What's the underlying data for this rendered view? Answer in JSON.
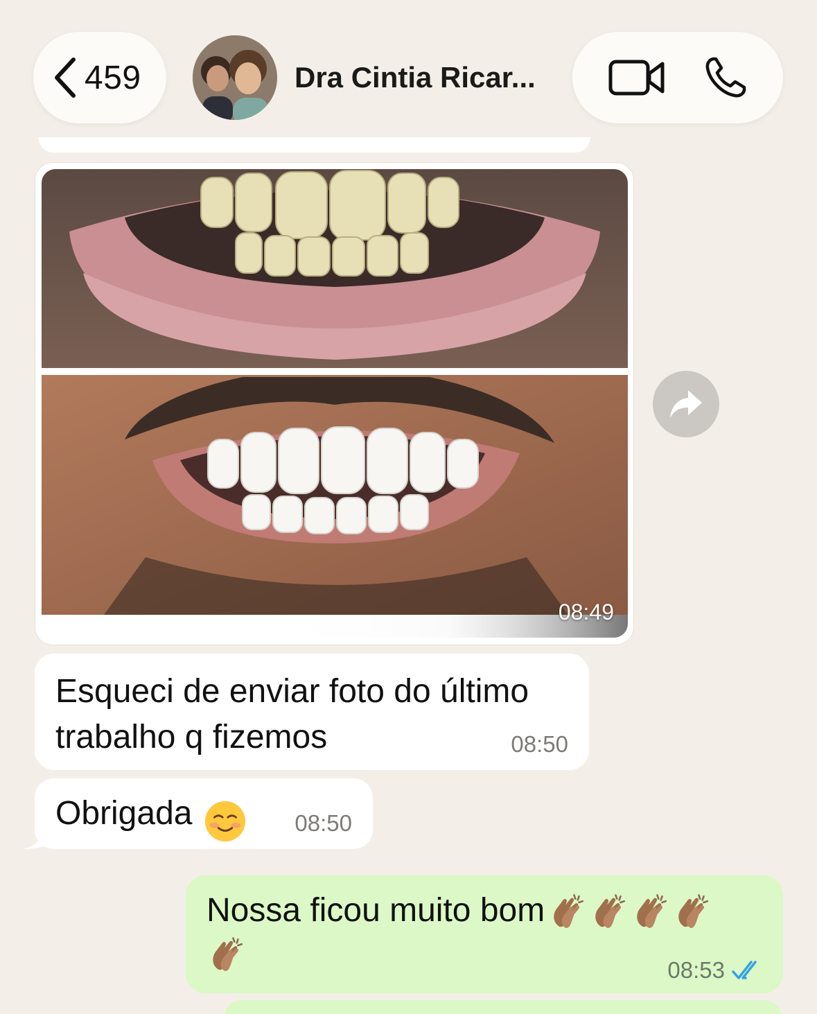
{
  "header": {
    "back_count": "459",
    "contact_name": "Dra Cintia Ricar...",
    "icons": [
      "chevron-left-icon",
      "video-camera-icon",
      "phone-icon"
    ]
  },
  "messages": [
    {
      "type": "image",
      "direction": "incoming",
      "time": "08:49"
    },
    {
      "type": "text",
      "direction": "incoming",
      "text": "Esqueci de enviar foto do último trabalho q fizemos",
      "time": "08:50"
    },
    {
      "type": "text",
      "direction": "incoming",
      "text": "Obrigada",
      "emoji": "☺️",
      "time": "08:50"
    },
    {
      "type": "text",
      "direction": "outgoing",
      "text": "Nossa ficou muito bom",
      "emoji": "👏🏽👏🏽👏🏽👏🏽👏🏽",
      "time": "08:53",
      "status": "read"
    }
  ],
  "colors": {
    "background": "#f3efe8",
    "incoming_bubble": "#ffffff",
    "outgoing_bubble": "#dcf8c6",
    "read_ticks": "#34a2e6"
  }
}
